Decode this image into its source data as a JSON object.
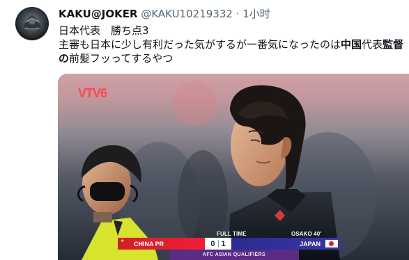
{
  "tweet": {
    "display_name": "KAKU@JOKER",
    "handle": "@KAKU10219332",
    "dot": "·",
    "time": "1小时",
    "line1": "日本代表　勝ち点3",
    "line2_part1": "主審も日本に少し有利だった気がするが一番気になったのは",
    "line2_bold": "中国",
    "line2_part2": "代表",
    "line2_bold2": "監督",
    "line3_bold": "の",
    "line3_part": "前髪フッってするやつ"
  },
  "media": {
    "broadcaster": "VTV",
    "channel_number": "6",
    "full_time_label": "FULL TIME",
    "other_match": "OSAKO 40'",
    "left_team": "CHINA PR",
    "left_score": "0",
    "right_score": "1",
    "right_team": "JAPAN",
    "competition": "AFC ASIAN QUALIFIERS"
  }
}
